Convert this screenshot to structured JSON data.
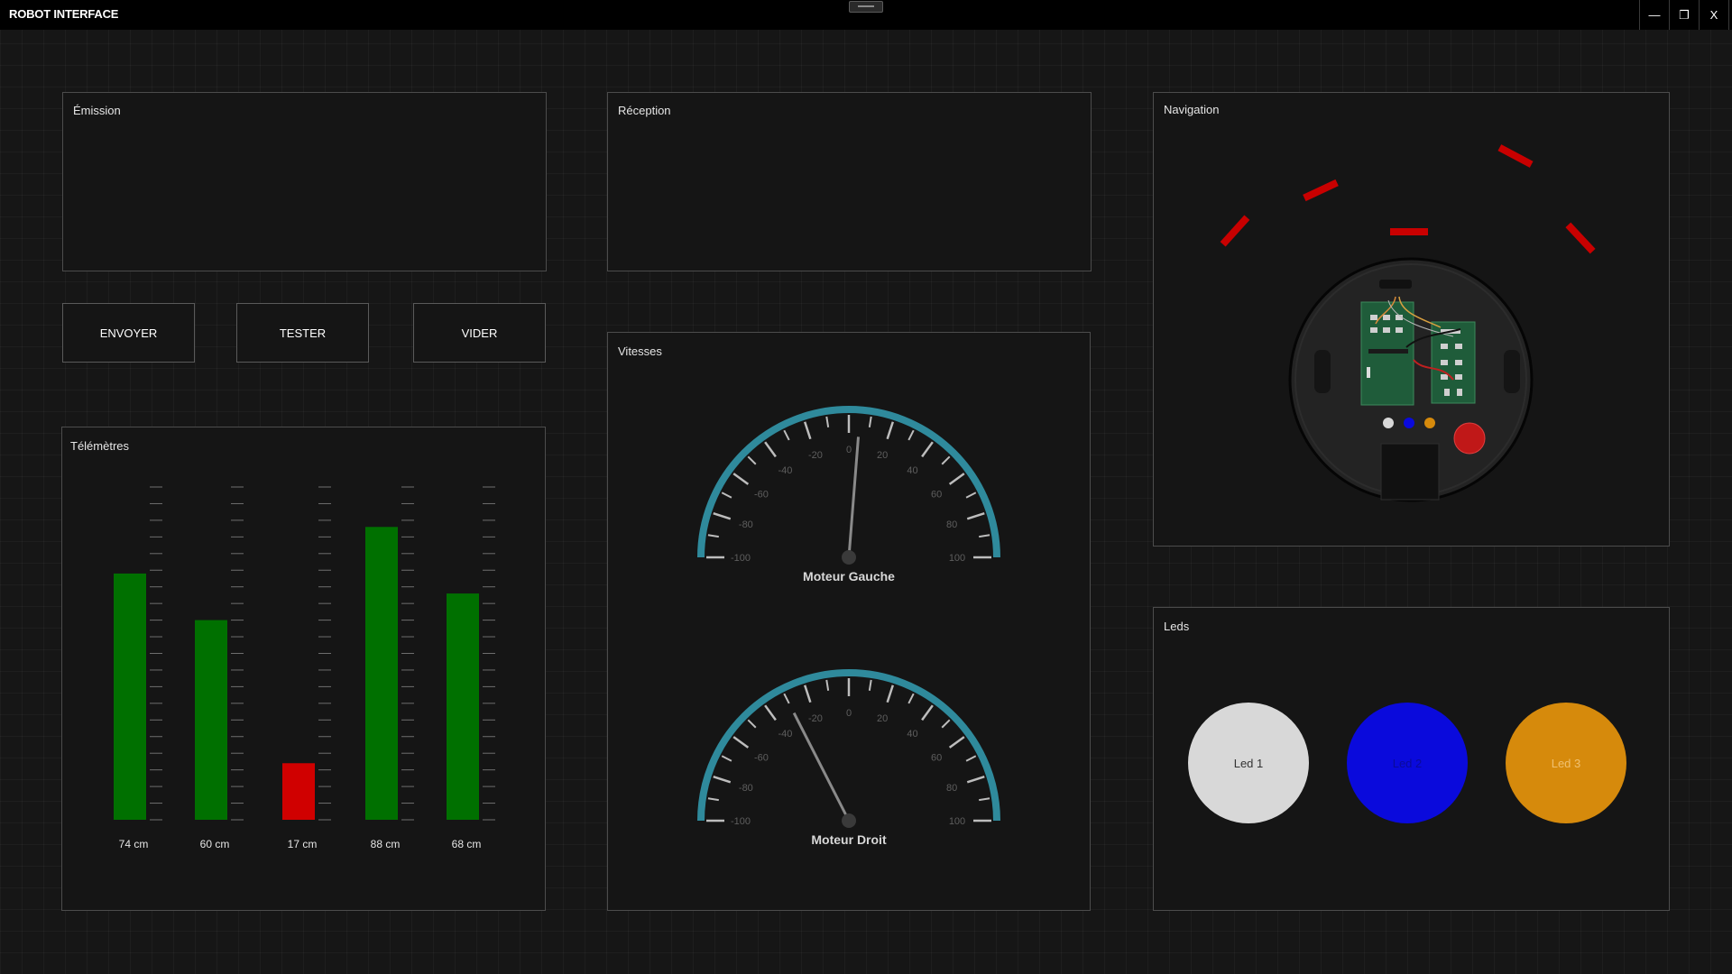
{
  "window": {
    "title": "ROBOT INTERFACE",
    "minimize_label": "—",
    "maximize_label": "❐",
    "close_label": "X"
  },
  "emission": {
    "title": "Émission",
    "content": ""
  },
  "reception": {
    "title": "Réception",
    "content": ""
  },
  "buttons": {
    "send": "ENVOYER",
    "test": "TESTER",
    "clear": "VIDER"
  },
  "telemeters": {
    "title": "Télémètres",
    "max_cm": 100,
    "bars": [
      {
        "label": "74 cm",
        "value": 74,
        "color": "#007000"
      },
      {
        "label": "60 cm",
        "value": 60,
        "color": "#007000"
      },
      {
        "label": "17 cm",
        "value": 17,
        "color": "#d00000"
      },
      {
        "label": "88 cm",
        "value": 88,
        "color": "#007000"
      },
      {
        "label": "68 cm",
        "value": 68,
        "color": "#007000"
      }
    ]
  },
  "speeds": {
    "title": "Vitesses",
    "gauges": [
      {
        "label": "Moteur Gauche",
        "value": 5,
        "min": -100,
        "max": 100
      },
      {
        "label": "Moteur Droit",
        "value": -30,
        "min": -100,
        "max": 100
      }
    ],
    "tick_labels": [
      "-100",
      "-80",
      "-60",
      "-40",
      "-20",
      "0",
      "20",
      "40",
      "60",
      "80",
      "100"
    ],
    "arc_color": "#2f8a9c"
  },
  "navigation": {
    "title": "Navigation",
    "obstacle_color": "#c80000"
  },
  "leds": {
    "title": "Leds",
    "items": [
      {
        "label": "Led 1",
        "color": "#d8d8d8",
        "text_color": "#333333"
      },
      {
        "label": "Led 2",
        "color": "#0a0adc",
        "text_color": "#0a0a9a"
      },
      {
        "label": "Led 3",
        "color": "#d68a0c",
        "text_color": "#f0c070"
      }
    ]
  }
}
